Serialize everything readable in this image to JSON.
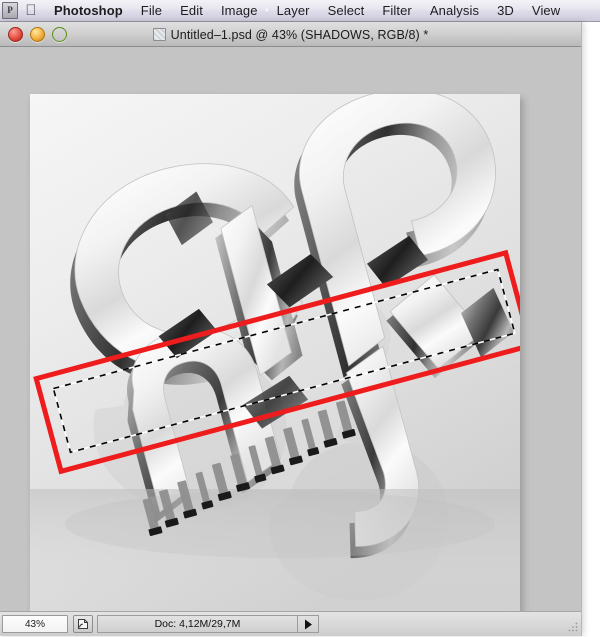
{
  "menubar": {
    "app_icon_letter": "P",
    "apple_icon": "apple-logo",
    "items": [
      {
        "label": "Photoshop",
        "bold": true
      },
      {
        "label": "File",
        "bold": false
      },
      {
        "label": "Edit",
        "bold": false
      },
      {
        "label": "Image",
        "bold": false
      },
      {
        "label": "Layer",
        "bold": false
      },
      {
        "label": "Select",
        "bold": false
      },
      {
        "label": "Filter",
        "bold": false
      },
      {
        "label": "Analysis",
        "bold": false
      },
      {
        "label": "3D",
        "bold": false
      },
      {
        "label": "View",
        "bold": false
      }
    ]
  },
  "window": {
    "title": "Untitled–1.psd @ 43% (SHADOWS, RGB/8) *",
    "traffic_lights": {
      "close": "close-button",
      "minimize": "minimize-button",
      "zoom": "maximize-button"
    },
    "proxy_icon": "document-thumbnail-icon"
  },
  "statusbar": {
    "zoom_level": "43%",
    "proxy_icon": "page-preview-icon",
    "doc_info": "Doc: 4,12M/29,7M",
    "popup_arrow": "▶",
    "resize_grip": "resize-grip-icon"
  },
  "artwork": {
    "description": "3D chrome extruded typography with reflection",
    "background_top": "#f4f4f4",
    "background_bottom": "#cfcfcf",
    "annotation_color": "#ee1c1c",
    "selection_style": "marching-ants-dashed"
  },
  "colors": {
    "menubar_top": "#f3f2f7",
    "menubar_bottom": "#cfcddd",
    "window_bg": "#c3c3c3",
    "titlebar_top": "#e0e0e0",
    "titlebar_bottom": "#b9b9b9",
    "accent_red": "#ee1c1c"
  }
}
